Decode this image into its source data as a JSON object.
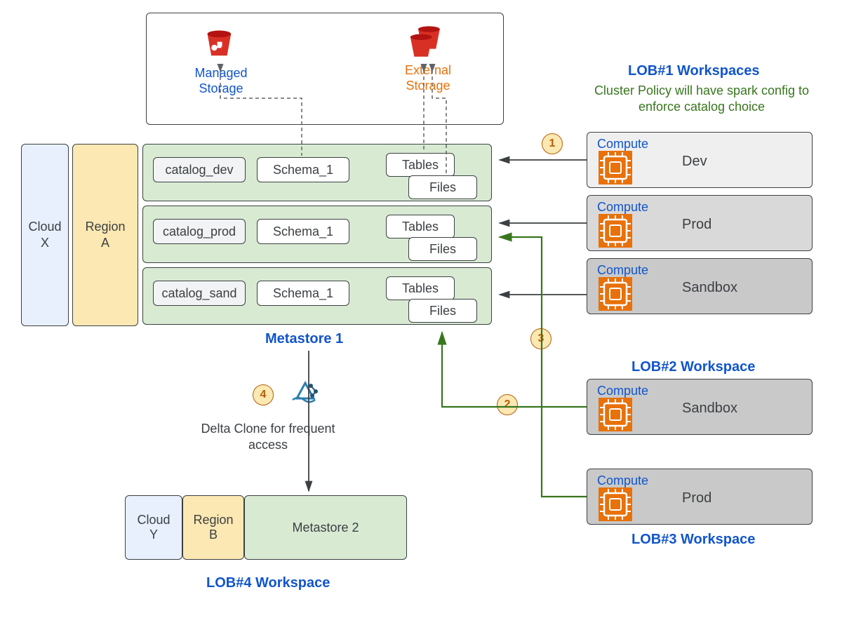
{
  "storage": {
    "managed": "Managed Storage",
    "external": "External Storage"
  },
  "cloud1": {
    "cloud": "Cloud X",
    "region": "Region A"
  },
  "cloud2": {
    "cloud": "Cloud Y",
    "region": "Region B"
  },
  "metastore1": "Metastore 1",
  "metastore2": "Metastore 2",
  "catalogs": [
    {
      "name": "catalog_dev",
      "schema": "Schema_1",
      "tables": "Tables",
      "files": "Files"
    },
    {
      "name": "catalog_prod",
      "schema": "Schema_1",
      "tables": "Tables",
      "files": "Files"
    },
    {
      "name": "catalog_sand",
      "schema": "Schema_1",
      "tables": "Tables",
      "files": "Files"
    }
  ],
  "lob1": {
    "title": "LOB#1 Workspaces",
    "subtitle": "Cluster Policy will have spark config to enforce catalog choice",
    "compute": "Compute",
    "workspaces": [
      "Dev",
      "Prod",
      "Sandbox"
    ]
  },
  "lob2": {
    "title": "LOB#2 Workspace",
    "compute": "Compute",
    "name": "Sandbox"
  },
  "lob3": {
    "title": "LOB#3 Workspace",
    "compute": "Compute",
    "name": "Prod"
  },
  "lob4": {
    "title": "LOB#4 Workspace"
  },
  "deltaClone": "Delta Clone for frequent  access",
  "badges": {
    "b1": "1",
    "b2": "2",
    "b3": "3",
    "b4": "4"
  }
}
